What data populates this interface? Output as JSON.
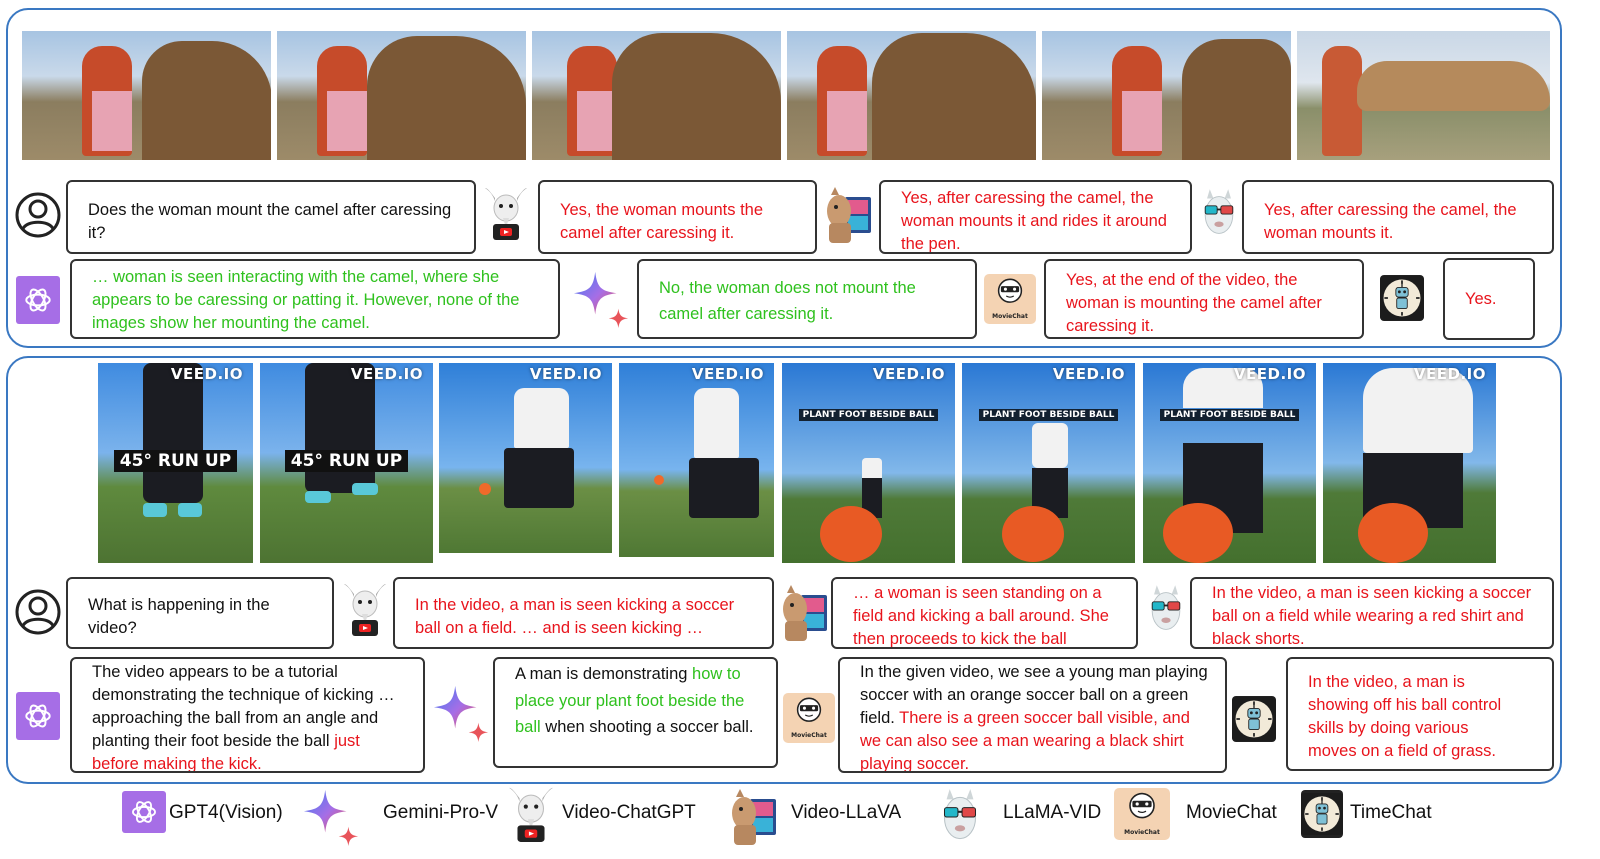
{
  "panel1": {
    "question": "Does the woman mount the camel after caressing it?",
    "answers": {
      "video_chatgpt": "Yes, the woman mounts the camel after caressing it.",
      "video_llava": "Yes, after caressing the camel, the woman mounts it and rides it around the pen.",
      "llama_vid": "Yes, after caressing the camel, the woman mounts it.",
      "gpt4v": "… woman is seen interacting with the camel, where she appears to be caressing or patting it. However, none of the images show her mounting the camel.",
      "gemini": "No, the woman does not mount the camel after caressing it.",
      "moviechat": "Yes, at the end of the video, the woman is mounting the camel after caressing it.",
      "timechat": "Yes."
    }
  },
  "panel2": {
    "question": "What is happening in the video?",
    "watermark": "VEED.IO",
    "captions": {
      "run_up": "45° RUN UP",
      "plant_foot": "PLANT FOOT BESIDE BALL"
    },
    "answers": {
      "video_chatgpt": "In the video, a man is seen kicking a soccer ball on a field. … and is seen kicking …",
      "video_llava": "… a woman is seen standing on a field and kicking a ball around. She then proceeds to kick the ball",
      "llama_vid": "In the video, a man is seen kicking a soccer ball on a field while wearing a red shirt and black shorts.",
      "gpt4v_a": "The video appears to be a tutorial demonstrating the technique of kicking … approaching the ball from an angle and planting their foot beside the ball",
      "gpt4v_b": "just before making the kick.",
      "gemini_a": "A man is demonstrating",
      "gemini_b": "how to place your plant foot beside the ball",
      "gemini_c": "when shooting a soccer ball.",
      "moviechat_a": "In the given video, we see a young man playing soccer with an orange soccer ball on a green field.",
      "moviechat_b": "There is a green soccer ball visible, and we can also see a man wearing a black shirt playing soccer.",
      "timechat": "In the video, a man is showing off his ball control skills by doing various moves on a field of grass."
    }
  },
  "icon_labels": {
    "moviechat": "MovieChat"
  },
  "legend": {
    "gpt4v": "GPT4(Vision)",
    "gemini": "Gemini-Pro-V",
    "video_chatgpt": "Video-ChatGPT",
    "video_llava": "Video-LLaVA",
    "llama_vid": "LLaMA-VID",
    "moviechat": "MovieChat",
    "timechat": "TimeChat"
  },
  "colors": {
    "panel_border": "#3a78c2",
    "incorrect_text": "#e8141c",
    "correct_text": "#2fc11e",
    "gpt_icon": "#a66ee6"
  }
}
